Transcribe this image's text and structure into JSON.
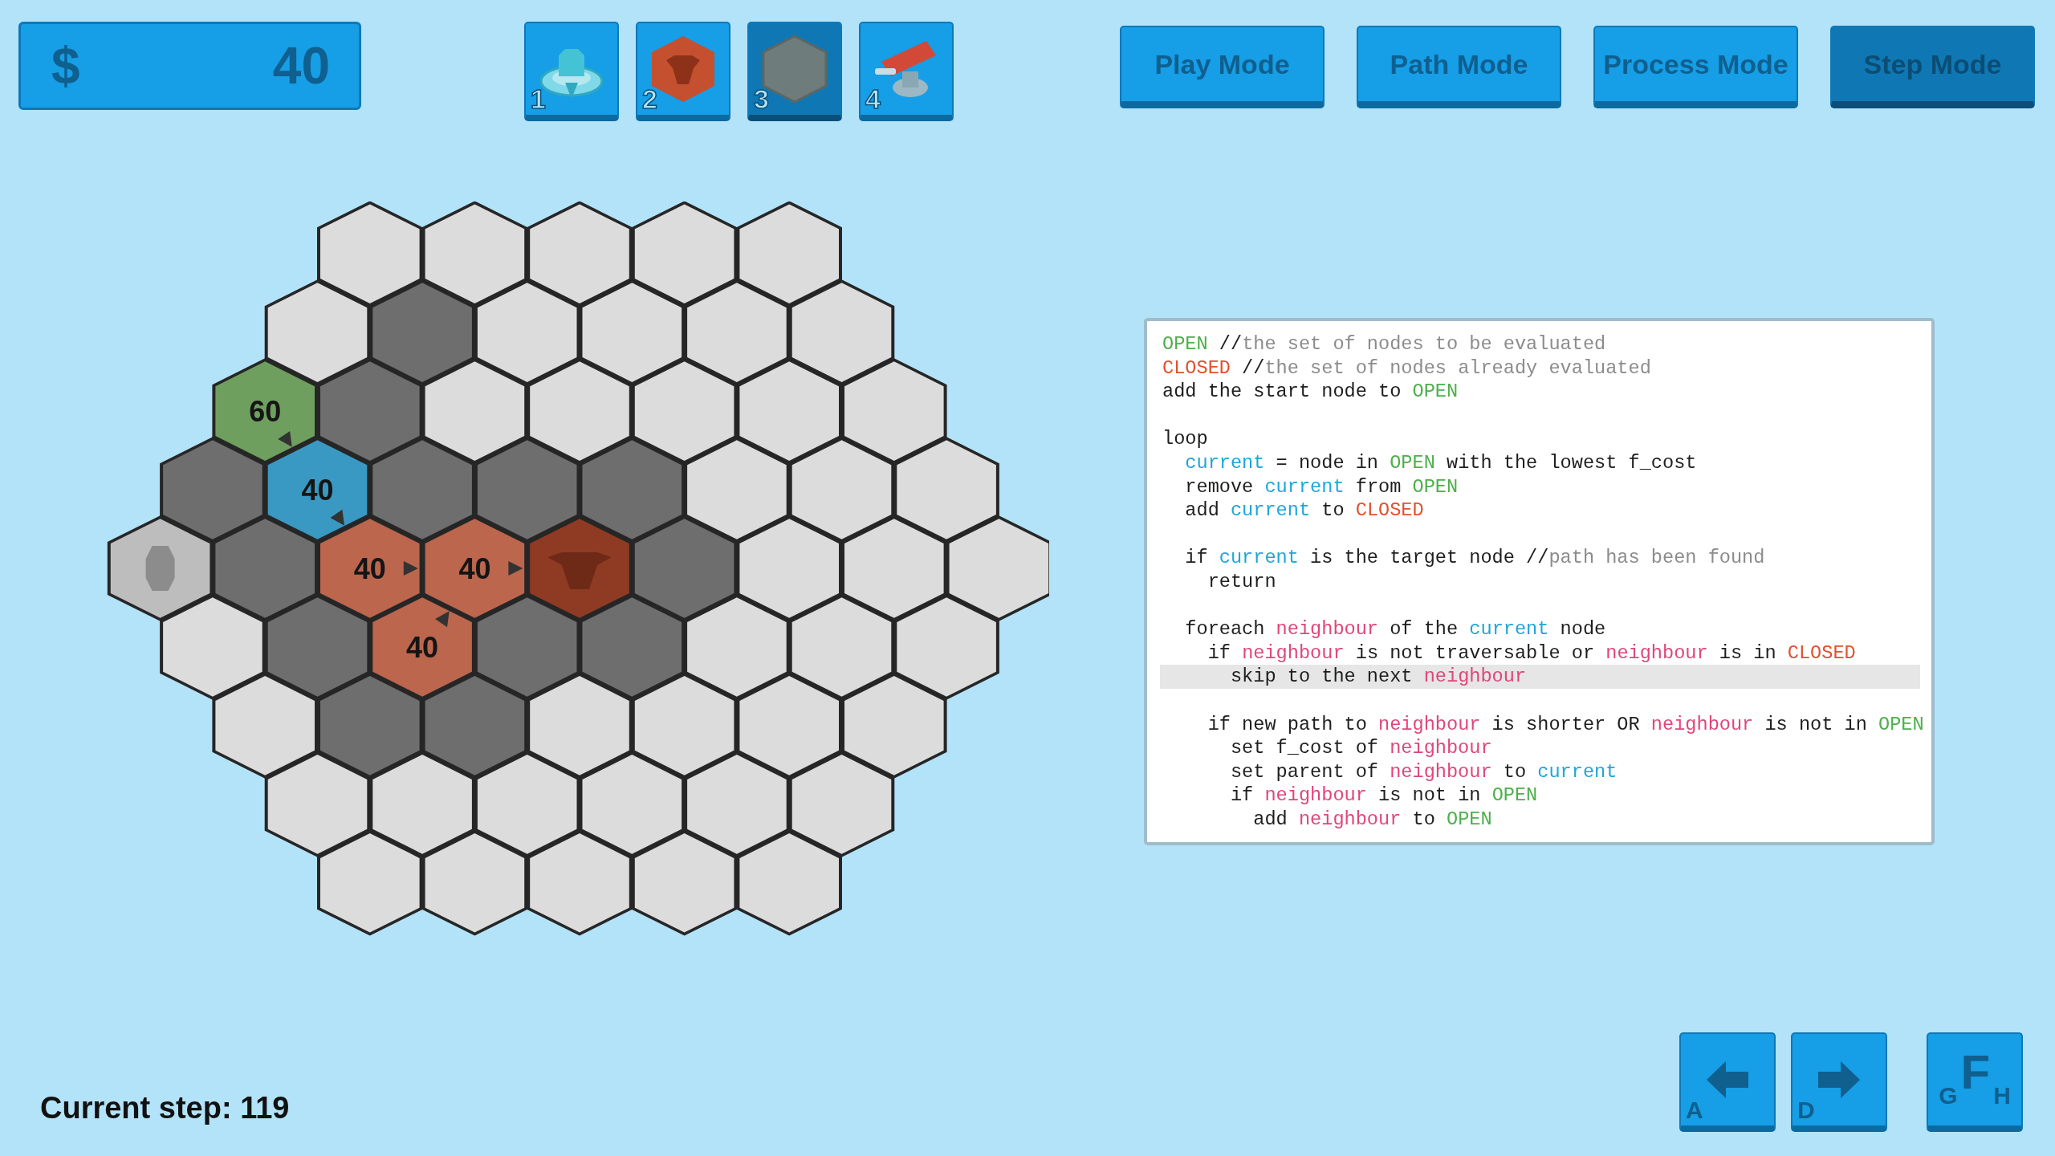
{
  "money": {
    "symbol": "$",
    "amount": "40"
  },
  "tools": [
    {
      "number": "1",
      "kind": "turret",
      "selected": false
    },
    {
      "number": "2",
      "kind": "target",
      "selected": false
    },
    {
      "number": "3",
      "kind": "wall",
      "selected": true
    },
    {
      "number": "4",
      "kind": "cannon",
      "selected": false
    }
  ],
  "modes": [
    {
      "label": "Play Mode",
      "selected": false
    },
    {
      "label": "Path Mode",
      "selected": false
    },
    {
      "label": "Process Mode",
      "selected": false
    },
    {
      "label": "Step Mode",
      "selected": true
    }
  ],
  "board": {
    "rows": [
      [
        {
          "kind": "empty"
        },
        {
          "kind": "empty"
        },
        {
          "kind": "empty"
        },
        {
          "kind": "empty"
        },
        {
          "kind": "empty"
        }
      ],
      [
        {
          "kind": "empty"
        },
        {
          "kind": "wall"
        },
        {
          "kind": "empty"
        },
        {
          "kind": "empty"
        },
        {
          "kind": "empty"
        },
        {
          "kind": "empty"
        }
      ],
      [
        {
          "kind": "open",
          "cost": "60",
          "arrow": {
            "kind": "se"
          }
        },
        {
          "kind": "wall"
        },
        {
          "kind": "empty"
        },
        {
          "kind": "empty"
        },
        {
          "kind": "empty"
        },
        {
          "kind": "empty"
        },
        {
          "kind": "empty"
        }
      ],
      [
        {
          "kind": "wall"
        },
        {
          "kind": "current",
          "cost": "40",
          "arrow": {
            "kind": "se"
          }
        },
        {
          "kind": "wall"
        },
        {
          "kind": "wall"
        },
        {
          "kind": "wall"
        },
        {
          "kind": "empty"
        },
        {
          "kind": "empty"
        },
        {
          "kind": "empty"
        }
      ],
      [
        {
          "kind": "start"
        },
        {
          "kind": "wall"
        },
        {
          "kind": "closed",
          "cost": "40",
          "arrow": {
            "kind": "e"
          }
        },
        {
          "kind": "closed",
          "cost": "40",
          "arrow": {
            "kind": "e"
          }
        },
        {
          "kind": "target"
        },
        {
          "kind": "wall"
        },
        {
          "kind": "empty"
        },
        {
          "kind": "empty"
        },
        {
          "kind": "empty"
        }
      ],
      [
        {
          "kind": "empty"
        },
        {
          "kind": "wall"
        },
        {
          "kind": "closed",
          "cost": "40",
          "arrow": {
            "kind": "ne"
          }
        },
        {
          "kind": "wall"
        },
        {
          "kind": "wall"
        },
        {
          "kind": "empty"
        },
        {
          "kind": "empty"
        },
        {
          "kind": "empty"
        }
      ],
      [
        {
          "kind": "empty"
        },
        {
          "kind": "wall"
        },
        {
          "kind": "wall"
        },
        {
          "kind": "empty"
        },
        {
          "kind": "empty"
        },
        {
          "kind": "empty"
        },
        {
          "kind": "empty"
        }
      ],
      [
        {
          "kind": "empty"
        },
        {
          "kind": "empty"
        },
        {
          "kind": "empty"
        },
        {
          "kind": "empty"
        },
        {
          "kind": "empty"
        },
        {
          "kind": "empty"
        }
      ],
      [
        {
          "kind": "empty"
        },
        {
          "kind": "empty"
        },
        {
          "kind": "empty"
        },
        {
          "kind": "empty"
        },
        {
          "kind": "empty"
        }
      ]
    ]
  },
  "code": {
    "lines": [
      {
        "highlighted": false,
        "gap_before": false,
        "segments": [
          {
            "text": "OPEN",
            "kind": "open"
          },
          {
            "text": " //",
            "kind": "plain"
          },
          {
            "text": "the set of nodes to be evaluated",
            "kind": "comment"
          }
        ]
      },
      {
        "highlighted": false,
        "gap_before": false,
        "segments": [
          {
            "text": "CLOSED",
            "kind": "closed"
          },
          {
            "text": " //",
            "kind": "plain"
          },
          {
            "text": "the set of nodes already evaluated",
            "kind": "comment"
          }
        ]
      },
      {
        "highlighted": false,
        "gap_before": false,
        "segments": [
          {
            "text": "add the start node to ",
            "kind": "plain"
          },
          {
            "text": "OPEN",
            "kind": "open"
          }
        ]
      },
      {
        "highlighted": false,
        "gap_before": true,
        "segments": [
          {
            "text": "loop",
            "kind": "plain"
          }
        ]
      },
      {
        "highlighted": false,
        "segments": [
          {
            "text": "  current",
            "kind": "current"
          },
          {
            "text": " = node in ",
            "kind": "plain"
          },
          {
            "text": "OPEN",
            "kind": "open"
          },
          {
            "text": " with the lowest f_cost",
            "kind": "plain"
          }
        ]
      },
      {
        "highlighted": false,
        "gap_before": false,
        "segments": [
          {
            "text": "  remove ",
            "kind": "plain"
          },
          {
            "text": "current",
            "kind": "current"
          },
          {
            "text": " from ",
            "kind": "plain"
          },
          {
            "text": "OPEN",
            "kind": "open"
          }
        ]
      },
      {
        "highlighted": false,
        "gap_before": false,
        "segments": [
          {
            "text": "  add ",
            "kind": "plain"
          },
          {
            "text": "current",
            "kind": "current"
          },
          {
            "text": " to ",
            "kind": "plain"
          },
          {
            "text": "CLOSED",
            "kind": "closed"
          }
        ]
      },
      {
        "highlighted": false,
        "gap_before": true,
        "segments": [
          {
            "text": "  if ",
            "kind": "plain"
          },
          {
            "text": "current",
            "kind": "current"
          },
          {
            "text": " is the target node //",
            "kind": "plain"
          },
          {
            "text": "path has been found",
            "kind": "comment"
          }
        ]
      },
      {
        "highlighted": false,
        "gap_before": false,
        "segments": [
          {
            "text": "    return",
            "kind": "plain"
          }
        ]
      },
      {
        "highlighted": false,
        "gap_before": true,
        "segments": [
          {
            "text": "  foreach ",
            "kind": "plain"
          },
          {
            "text": "neighbour",
            "kind": "neighbour"
          },
          {
            "text": " of the ",
            "kind": "plain"
          },
          {
            "text": "current",
            "kind": "current"
          },
          {
            "text": " node",
            "kind": "plain"
          }
        ]
      },
      {
        "highlighted": false,
        "gap_before": false,
        "segments": [
          {
            "text": "    if ",
            "kind": "plain"
          },
          {
            "text": "neighbour",
            "kind": "neighbour"
          },
          {
            "text": " is not traversable or ",
            "kind": "plain"
          },
          {
            "text": "neighbour",
            "kind": "neighbour"
          },
          {
            "text": " is in ",
            "kind": "plain"
          },
          {
            "text": "CLOSED",
            "kind": "closed"
          }
        ]
      },
      {
        "highlighted": true,
        "gap_before": false,
        "segments": [
          {
            "text": "      skip to the next ",
            "kind": "plain"
          },
          {
            "text": "neighbour",
            "kind": "neighbour"
          }
        ]
      },
      {
        "highlighted": false,
        "gap_before": true,
        "segments": [
          {
            "text": "    if new path to ",
            "kind": "plain"
          },
          {
            "text": "neighbour",
            "kind": "neighbour"
          },
          {
            "text": " is shorter OR ",
            "kind": "plain"
          },
          {
            "text": "neighbour",
            "kind": "neighbour"
          },
          {
            "text": " is not in ",
            "kind": "plain"
          },
          {
            "text": "OPEN",
            "kind": "open"
          }
        ]
      },
      {
        "highlighted": false,
        "gap_before": false,
        "segments": [
          {
            "text": "      set f_cost of ",
            "kind": "plain"
          },
          {
            "text": "neighbour",
            "kind": "neighbour"
          }
        ]
      },
      {
        "highlighted": false,
        "gap_before": false,
        "segments": [
          {
            "text": "      set parent of ",
            "kind": "plain"
          },
          {
            "text": "neighbour",
            "kind": "neighbour"
          },
          {
            "text": " to ",
            "kind": "plain"
          },
          {
            "text": "current",
            "kind": "current"
          }
        ]
      },
      {
        "highlighted": false,
        "gap_before": false,
        "segments": [
          {
            "text": "      if ",
            "kind": "plain"
          },
          {
            "text": "neighbour",
            "kind": "neighbour"
          },
          {
            "text": " is not in ",
            "kind": "plain"
          },
          {
            "text": "OPEN",
            "kind": "open"
          }
        ]
      },
      {
        "highlighted": false,
        "gap_before": false,
        "segments": [
          {
            "text": "        add ",
            "kind": "plain"
          },
          {
            "text": "neighbour",
            "kind": "neighbour"
          },
          {
            "text": " to ",
            "kind": "plain"
          },
          {
            "text": "OPEN",
            "kind": "open"
          }
        ]
      }
    ]
  },
  "status": {
    "label": "Current step:",
    "value": "119"
  },
  "controls": [
    {
      "kind": "left",
      "keys": [
        "A"
      ]
    },
    {
      "kind": "right",
      "keys": [
        "D"
      ]
    },
    {
      "kind": "combo",
      "keys": [
        "G",
        "F",
        "H"
      ]
    }
  ]
}
